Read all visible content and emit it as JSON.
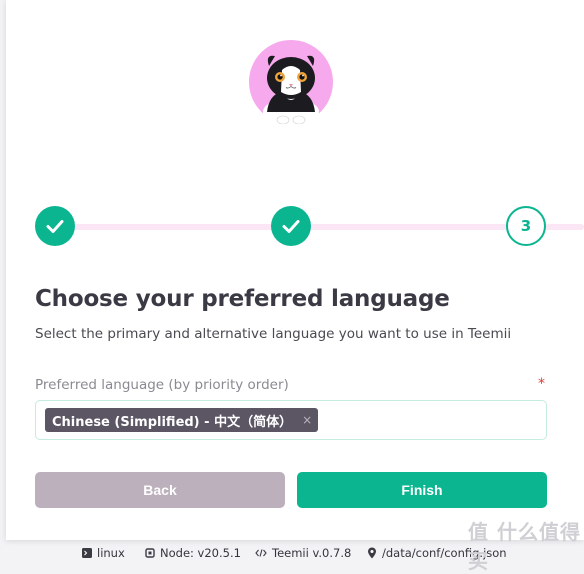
{
  "stepper": {
    "steps": [
      {
        "state": "completed",
        "icon": "check-icon"
      },
      {
        "state": "completed",
        "icon": "check-icon"
      },
      {
        "state": "active",
        "label": "3"
      }
    ]
  },
  "main": {
    "title": "Choose your preferred language",
    "subtitle": "Select the primary and alternative language you want to use in Teemii",
    "field": {
      "label": "Preferred language (by priority order)",
      "required_mark": "*",
      "selected": [
        {
          "label": "Chinese (Simplified) - 中文（简体）",
          "remove": "×"
        }
      ]
    },
    "buttons": {
      "back": "Back",
      "finish": "Finish"
    }
  },
  "footer": {
    "os": "linux",
    "node": "Node: v20.5.1",
    "version": "Teemii v.0.7.8",
    "config_path": "/data/conf/config.json"
  },
  "watermark": "值 什么值得买",
  "colors": {
    "accent": "#0ab590",
    "chip": "#5b5564",
    "back_button": "#bcb0bc",
    "progress_track": "#fbe6f6"
  }
}
